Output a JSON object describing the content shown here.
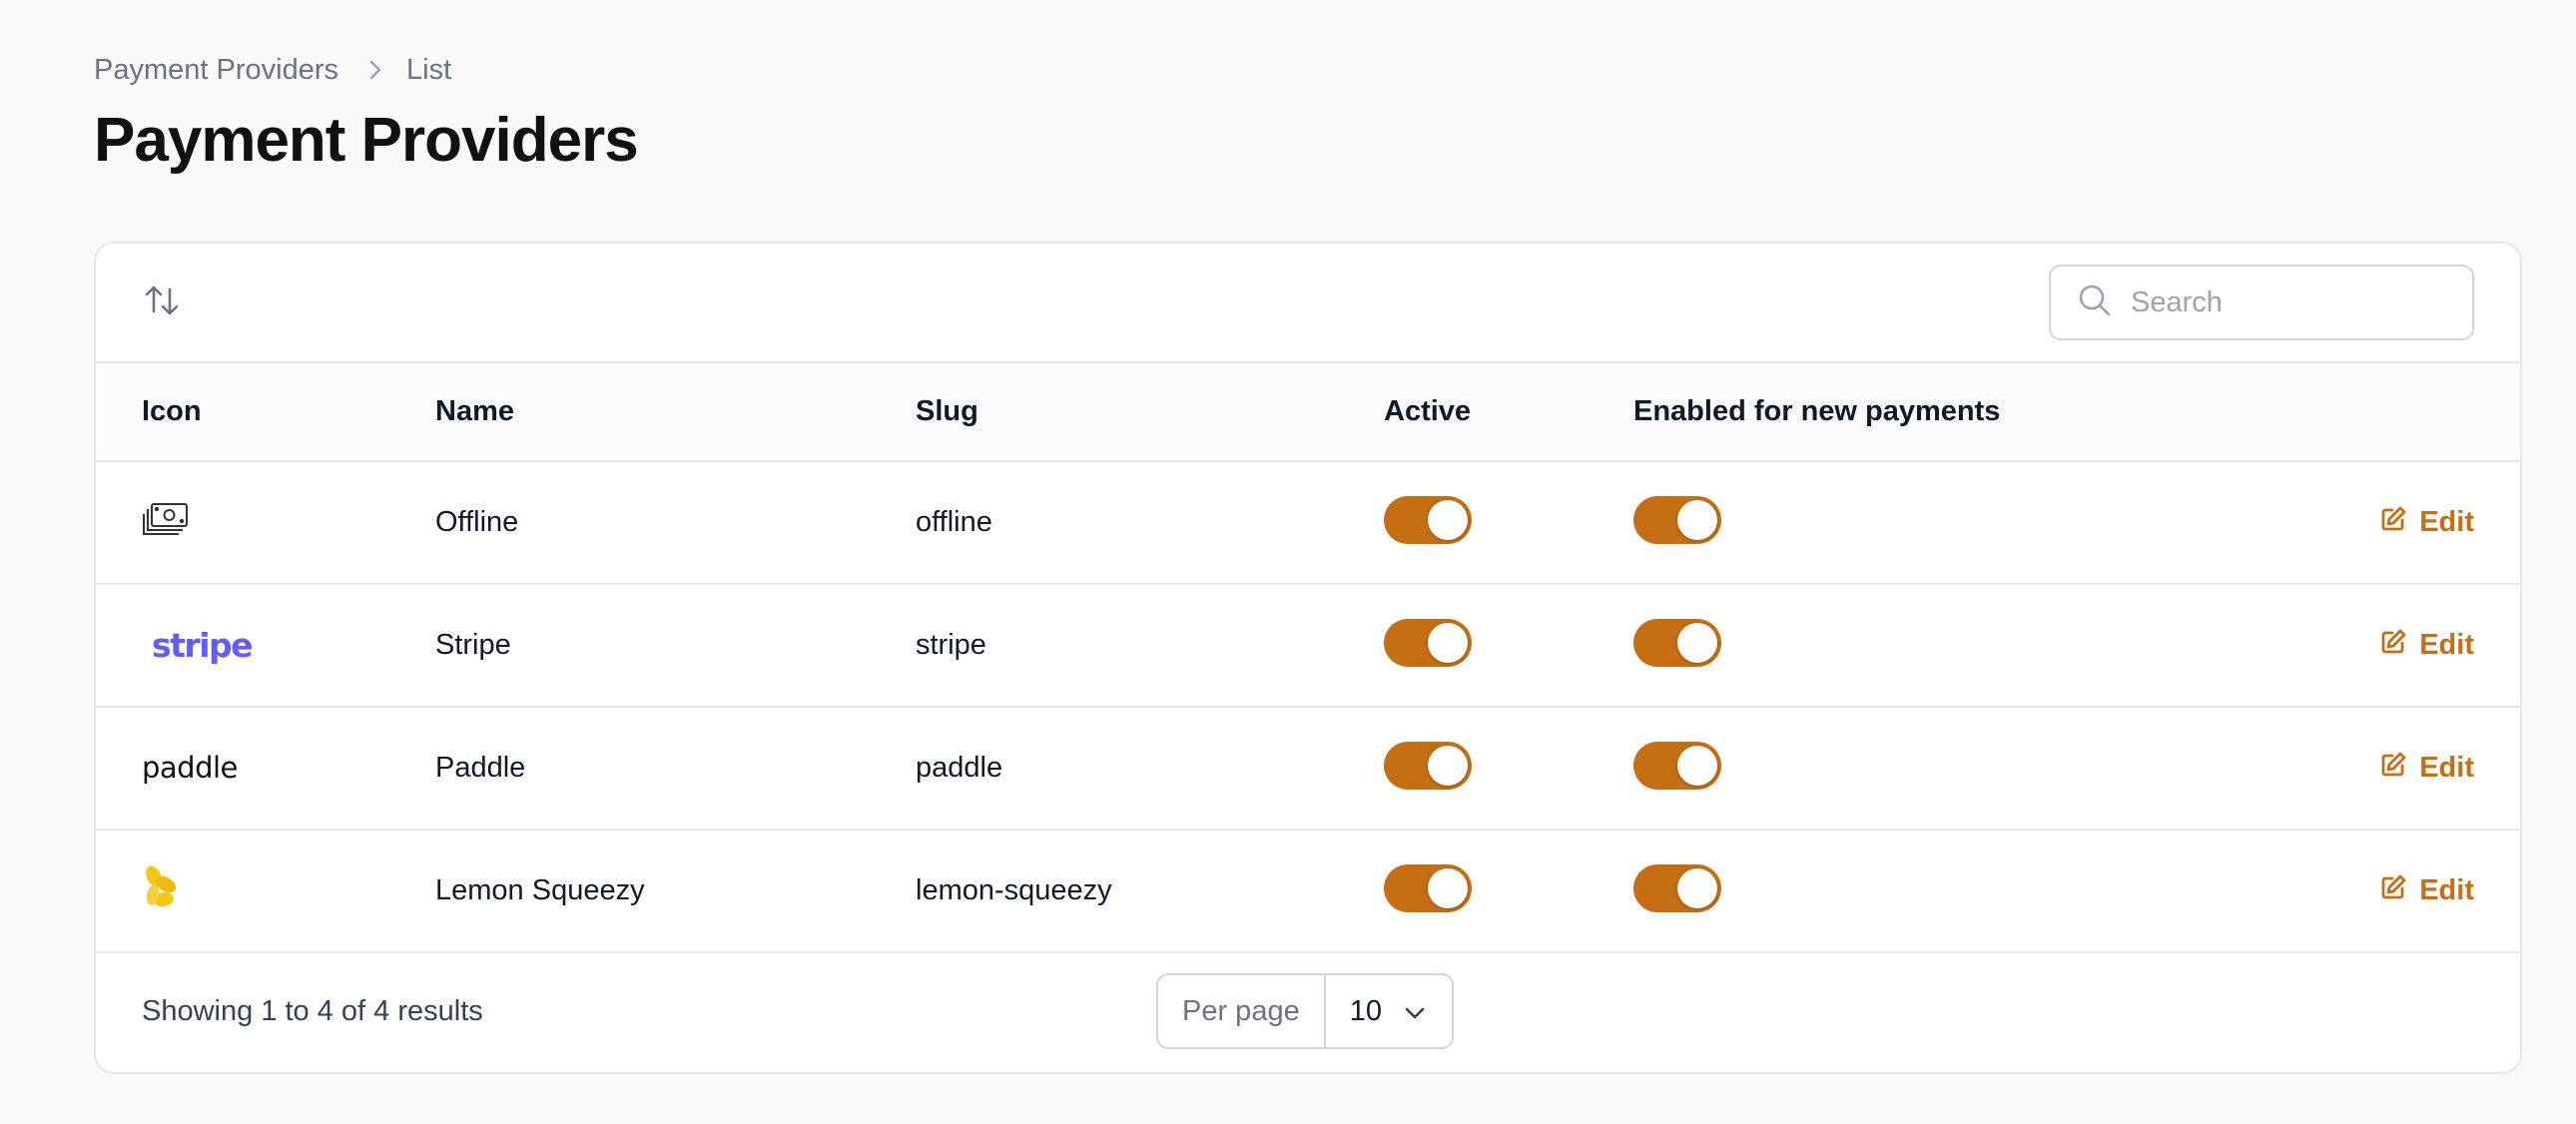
{
  "breadcrumb": {
    "parent": "Payment Providers",
    "current": "List"
  },
  "page_title": "Payment Providers",
  "search": {
    "placeholder": "Search",
    "value": ""
  },
  "table": {
    "columns": {
      "icon": "Icon",
      "name": "Name",
      "slug": "Slug",
      "active": "Active",
      "enabled": "Enabled for new payments"
    },
    "rows": [
      {
        "icon": "cash-stack-icon",
        "name": "Offline",
        "slug": "offline",
        "active": true,
        "enabled": true,
        "action": "Edit"
      },
      {
        "icon": "stripe-logo",
        "logo_text": "stripe",
        "name": "Stripe",
        "slug": "stripe",
        "active": true,
        "enabled": true,
        "action": "Edit"
      },
      {
        "icon": "paddle-logo",
        "logo_text": "paddle",
        "name": "Paddle",
        "slug": "paddle",
        "active": true,
        "enabled": true,
        "action": "Edit"
      },
      {
        "icon": "lemon-squeezy-logo",
        "name": "Lemon Squeezy",
        "slug": "lemon-squeezy",
        "active": true,
        "enabled": true,
        "action": "Edit"
      }
    ]
  },
  "footer": {
    "showing": "Showing 1 to 4 of 4 results",
    "per_page_label": "Per page",
    "per_page_value": "10"
  },
  "colors": {
    "accent": "#c56e12",
    "stripe": "#635bff",
    "lemon": "#f5c518",
    "background": "#f9f9f9"
  }
}
